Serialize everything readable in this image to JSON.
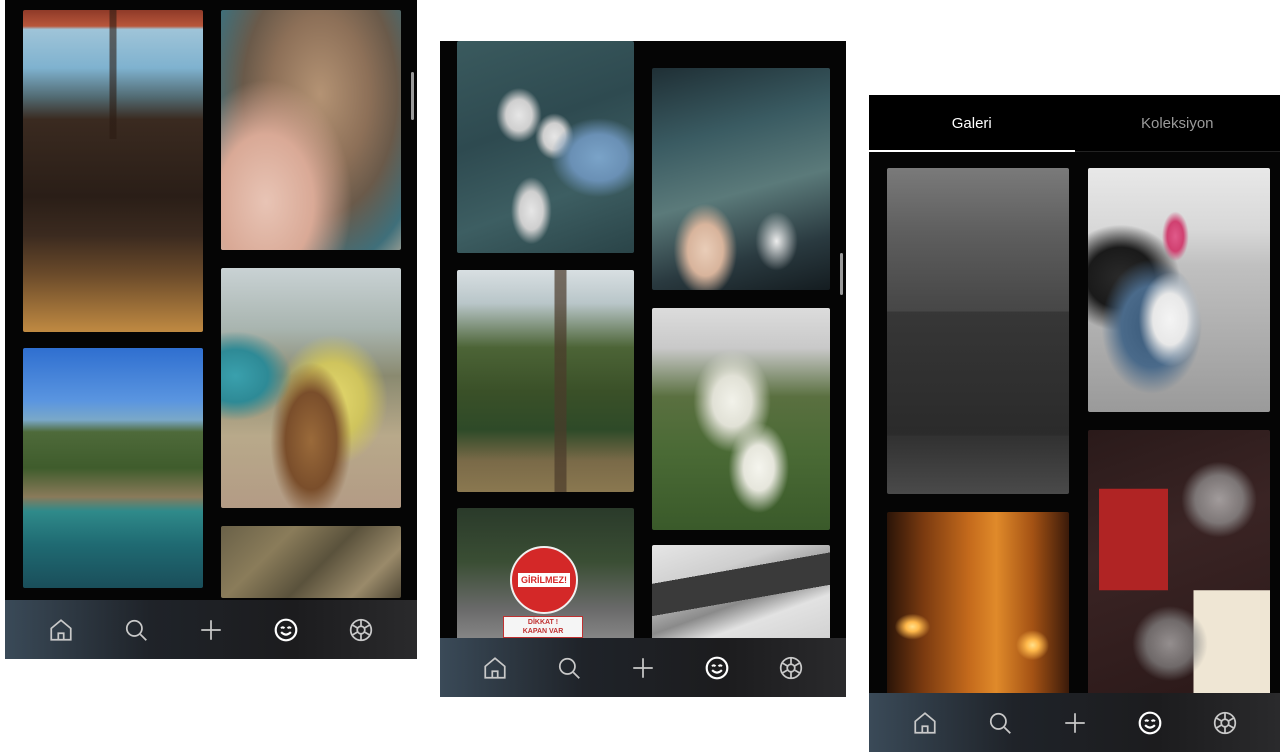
{
  "screens": [
    {
      "nav": [
        "home-icon",
        "search-icon",
        "plus-icon",
        "smiley-icon",
        "aperture-icon"
      ],
      "active_nav": "smiley-icon"
    },
    {
      "nav": [
        "home-icon",
        "search-icon",
        "plus-icon",
        "smiley-icon",
        "aperture-icon"
      ],
      "active_nav": "smiley-icon",
      "photo_texts": {
        "sign_main": "GİRİLMEZ!",
        "sign_sub_1": "DİKKAT !",
        "sign_sub_2": "KAPAN VAR"
      }
    },
    {
      "tabs": [
        {
          "label": "Galeri",
          "active": true
        },
        {
          "label": "Koleksiyon",
          "active": false
        }
      ],
      "nav": [
        "home-icon",
        "search-icon",
        "plus-icon",
        "smiley-icon",
        "aperture-icon"
      ],
      "active_nav": "smiley-icon"
    }
  ],
  "colors": {
    "background": "#050505",
    "nav_icon": "#c9c9c9",
    "nav_icon_active": "#ffffff",
    "tab_active": "#ffffff",
    "tab_inactive": "#9a9a9a"
  }
}
